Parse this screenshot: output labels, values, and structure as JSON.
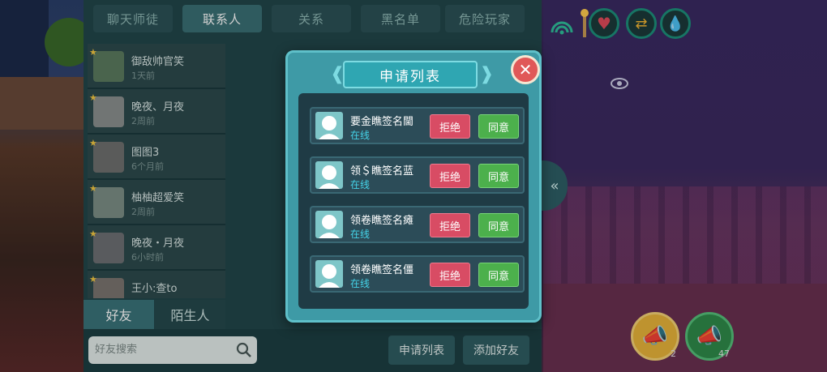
{
  "tabs": [
    "聊天师徒",
    "联系人",
    "关系",
    "黑名单",
    "危险玩家"
  ],
  "active_tab_index": 1,
  "friends": [
    {
      "name": "御敌帅官笑",
      "time": "1天前",
      "starred": true
    },
    {
      "name": "晚夜、月夜",
      "time": "2周前",
      "starred": true
    },
    {
      "name": "图图3",
      "time": "6个月前",
      "starred": true
    },
    {
      "name": "柚柚超爱笑",
      "time": "2周前",
      "starred": true
    },
    {
      "name": "晚夜・月夜",
      "time": "6小时前",
      "starred": true
    },
    {
      "name": "王小:查to",
      "time": "",
      "starred": true
    }
  ],
  "sub_tabs": {
    "friends": "好友",
    "strangers": "陌生人"
  },
  "search": {
    "placeholder": "好友搜索"
  },
  "bottom_buttons": {
    "requests": "申请列表",
    "add_friend": "添加好友"
  },
  "modal": {
    "title": "申请列表",
    "requests": [
      {
        "name": "要金瞧签名閫",
        "status": "在线",
        "reject": "拒绝",
        "accept": "同意"
      },
      {
        "name": "领＄瞧签名蓝",
        "status": "在线",
        "reject": "拒绝",
        "accept": "同意"
      },
      {
        "name": "领卷瞧签名瘫",
        "status": "在线",
        "reject": "拒绝",
        "accept": "同意"
      },
      {
        "name": "领卷瞧签名僵",
        "status": "在线",
        "reject": "拒绝",
        "accept": "同意"
      }
    ]
  },
  "hud": {
    "megaphone_left_count": "2",
    "megaphone_right_count": "47"
  },
  "colors": {
    "panel": "#21464a",
    "modal": "#3e9aa6",
    "reject": "#d84c64",
    "accept": "#4cb04c",
    "online": "#45d3e8"
  }
}
